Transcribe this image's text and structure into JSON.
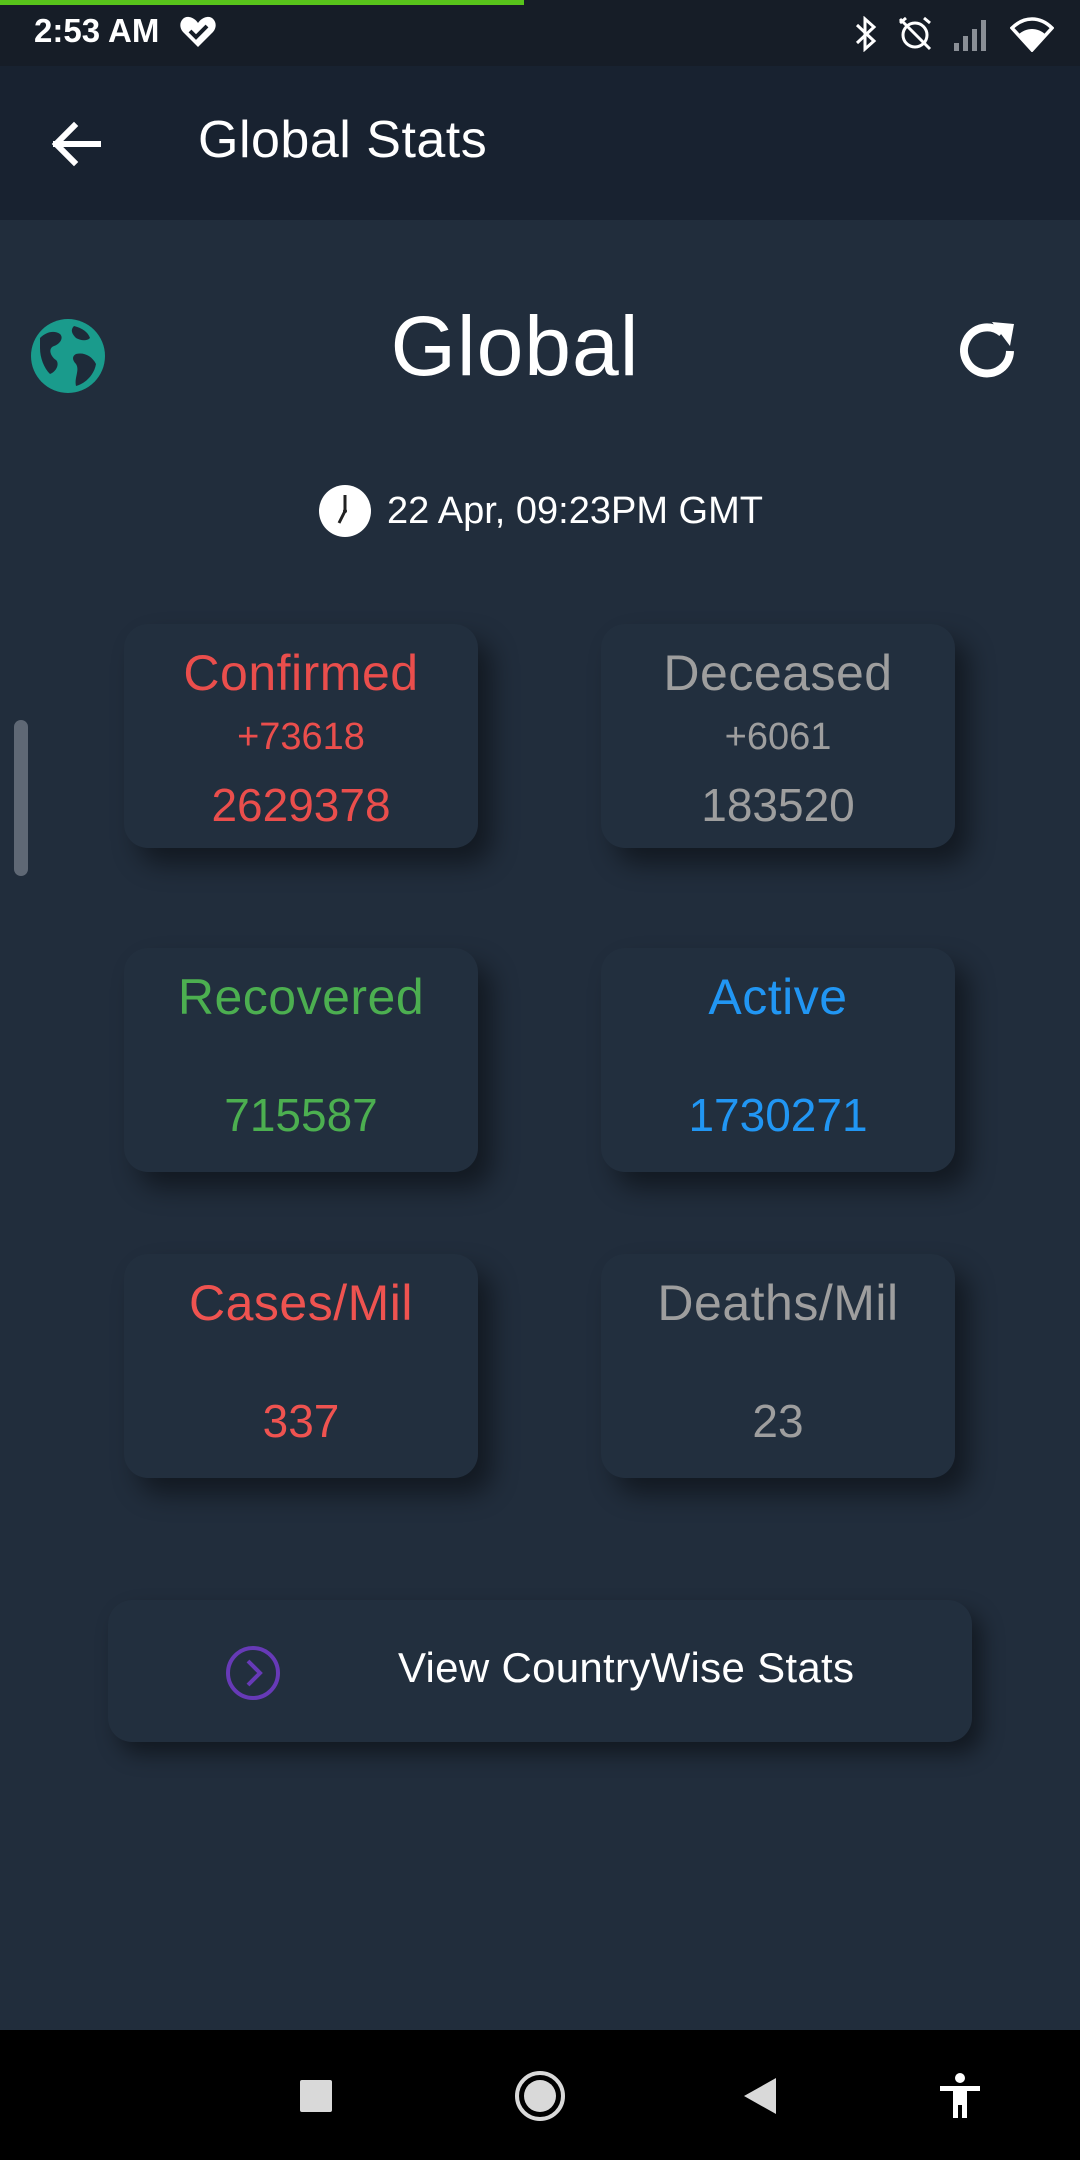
{
  "status_bar": {
    "time": "2:53 AM",
    "icons": [
      "heart-check-icon",
      "bluetooth-icon",
      "alarm-off-icon",
      "signal-icon",
      "wifi-icon"
    ],
    "progress_fraction": 0.485
  },
  "app_bar": {
    "title": "Global Stats",
    "back_icon": "arrow-left-icon"
  },
  "header": {
    "region": "Global",
    "globe_icon": "globe-icon",
    "refresh_icon": "refresh-icon"
  },
  "updated": {
    "icon": "clock-icon",
    "text": "22 Apr, 09:23PM GMT"
  },
  "stats": {
    "confirmed": {
      "label": "Confirmed",
      "delta": "+73618",
      "value": "2629378",
      "color": "#ea4e4c"
    },
    "deceased": {
      "label": "Deceased",
      "delta": "+6061",
      "value": "183520",
      "color": "#9e9e9e"
    },
    "recovered": {
      "label": "Recovered",
      "value": "715587",
      "color": "#4caf50"
    },
    "active": {
      "label": "Active",
      "value": "1730271",
      "color": "#2196f3"
    },
    "cases_per_mil": {
      "label": "Cases/Mil",
      "value": "337",
      "color": "#ef5350"
    },
    "deaths_per_mil": {
      "label": "Deaths/Mil",
      "value": "23",
      "color": "#9e9e9e"
    }
  },
  "countrywise_button": {
    "label": "View CountryWise Stats",
    "icon": "chevron-right-circle-icon",
    "icon_color": "#673ab7"
  },
  "nav_bar": {
    "icons": [
      "recents-square-icon",
      "home-circle-icon",
      "back-triangle-icon",
      "accessibility-icon"
    ]
  },
  "colors": {
    "background": "#212d3c",
    "app_bar": "#182230",
    "card": "#222f3e",
    "progress": "#57c31b"
  }
}
